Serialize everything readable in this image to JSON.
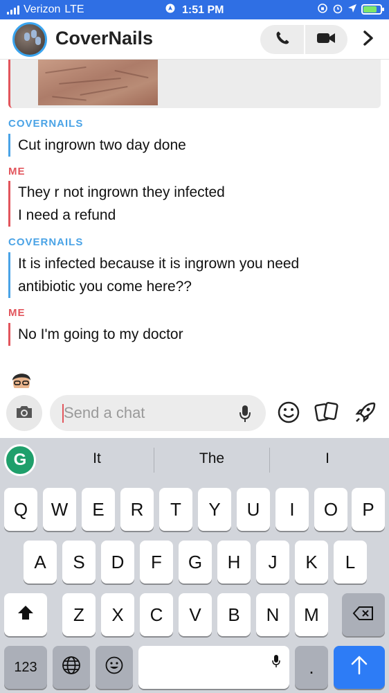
{
  "status_bar": {
    "carrier": "Verizon",
    "network": "LTE",
    "time": "1:51 PM",
    "battery_level": 0.8,
    "icons": [
      "location-arrow-icon",
      "screen-rotation-lock-icon",
      "alarm-icon",
      "location-icon",
      "battery-charging-icon"
    ]
  },
  "header": {
    "title": "CoverNails",
    "icons": [
      "phone-icon",
      "video-camera-icon",
      "chevron-right-icon"
    ]
  },
  "chat": {
    "messages": [
      {
        "sender": "COVERNAILS",
        "side": "them",
        "text": "Cut ingrown two day done"
      },
      {
        "sender": "ME",
        "side": "me",
        "lines": [
          "They r not ingrown they infected",
          "I need a refund"
        ]
      },
      {
        "sender": "COVERNAILS",
        "side": "them",
        "lines": [
          "It is infected because it is ingrown you need",
          "antibiotic  you come here??"
        ]
      },
      {
        "sender": "ME",
        "side": "me",
        "text": "No I'm going to my doctor"
      }
    ]
  },
  "input": {
    "placeholder": "Send a chat",
    "icons": [
      "camera-icon",
      "microphone-icon",
      "smiley-icon",
      "cards-icon",
      "rocket-icon"
    ]
  },
  "keyboard": {
    "suggestions": [
      "It",
      "The",
      "I"
    ],
    "row1": [
      "Q",
      "W",
      "E",
      "R",
      "T",
      "Y",
      "U",
      "I",
      "O",
      "P"
    ],
    "row2": [
      "A",
      "S",
      "D",
      "F",
      "G",
      "H",
      "J",
      "K",
      "L"
    ],
    "row3": [
      "Z",
      "X",
      "C",
      "V",
      "B",
      "N",
      "M"
    ],
    "num_key": "123",
    "period_key": ".",
    "colors": {
      "accent_blue": "#2d7cf6",
      "me_red": "#e2555c",
      "them_blue": "#4aa3e6",
      "status_bar": "#2f6fe4"
    }
  }
}
